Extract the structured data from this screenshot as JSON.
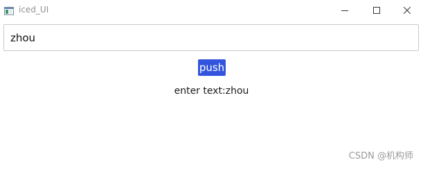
{
  "window": {
    "title": "iced_UI"
  },
  "input": {
    "value": "zhou"
  },
  "button": {
    "label": "push",
    "color": "#3355dd"
  },
  "output": {
    "text": "enter text:zhou"
  },
  "watermark": {
    "text": "CSDN @机构师"
  },
  "icons": {
    "app": "app-window-icon",
    "minimize": "minimize-icon",
    "maximize": "maximize-icon",
    "close": "close-icon"
  }
}
